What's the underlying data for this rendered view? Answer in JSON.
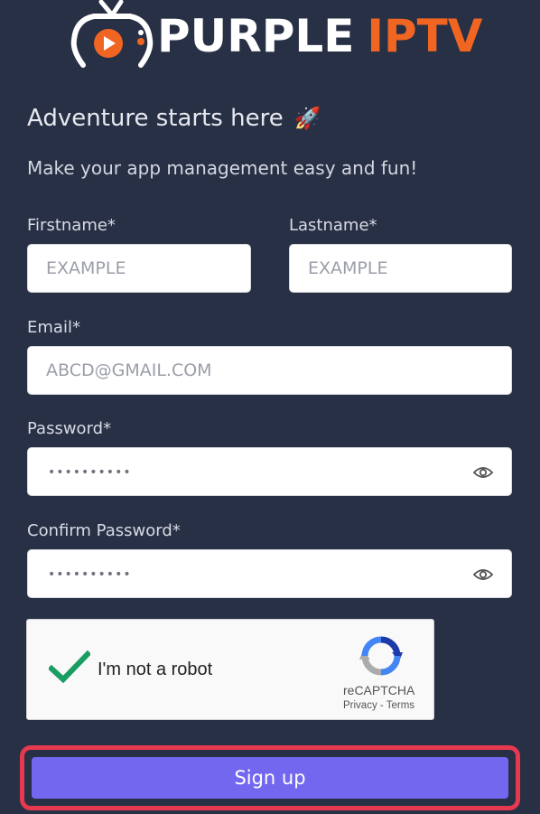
{
  "brand": {
    "name_white": "PURPLE",
    "name_orange": "IPTV",
    "orange": "#f06522"
  },
  "heading": {
    "title": "Adventure starts here",
    "emoji": "🚀"
  },
  "subtitle": "Make your app management easy and fun!",
  "form": {
    "firstname": {
      "label": "Firstname*",
      "placeholder": "EXAMPLE"
    },
    "lastname": {
      "label": "Lastname*",
      "placeholder": "EXAMPLE"
    },
    "email": {
      "label": "Email*",
      "placeholder": "ABCD@GMAIL.COM"
    },
    "password": {
      "label": "Password*",
      "value": "••••••••••"
    },
    "confirm_password": {
      "label": "Confirm Password*",
      "value": "••••••••••"
    }
  },
  "recaptcha": {
    "label": "I'm not a robot",
    "brand": "reCAPTCHA",
    "privacy": "Privacy",
    "separator": " - ",
    "terms": "Terms"
  },
  "signup": {
    "label": "Sign up",
    "color": "#7367f0",
    "highlight": "#e63950"
  }
}
